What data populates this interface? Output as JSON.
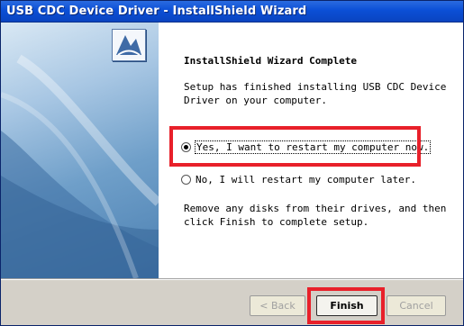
{
  "window": {
    "title": "USB CDC Device Driver - InstallShield Wizard"
  },
  "content": {
    "heading": "InstallShield Wizard Complete",
    "setup_text": "Setup has finished installing USB CDC Device Driver on your computer.",
    "options": [
      {
        "label": "Yes, I want to restart my computer now.",
        "selected": true
      },
      {
        "label": "No, I will restart my computer later.",
        "selected": false
      }
    ],
    "footer_text": "Remove any disks from their drives, and then click Finish to complete setup."
  },
  "buttons": {
    "back": "< Back",
    "finish": "Finish",
    "cancel": "Cancel"
  },
  "colors": {
    "highlight": "#e8202a",
    "titlebar": "#0b4fd6"
  },
  "icons": {
    "logo": "installshield-logo-icon",
    "radio_selected": "radio-selected-icon",
    "radio_unselected": "radio-unselected-icon"
  }
}
